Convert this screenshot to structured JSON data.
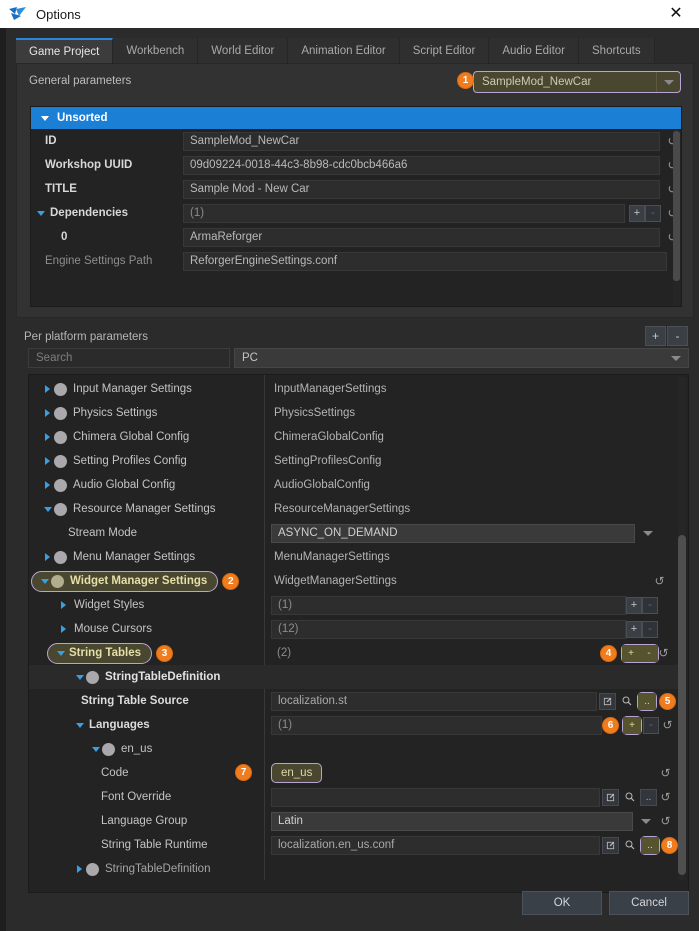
{
  "window": {
    "title": "Options",
    "close_icon": "close-icon",
    "logo_icon": "enfusion-logo-icon"
  },
  "tabs": [
    {
      "label": "Game Project",
      "active": true
    },
    {
      "label": "Workbench",
      "active": false
    },
    {
      "label": "World Editor",
      "active": false
    },
    {
      "label": "Animation Editor",
      "active": false
    },
    {
      "label": "Script Editor",
      "active": false
    },
    {
      "label": "Audio Editor",
      "active": false
    },
    {
      "label": "Shortcuts",
      "active": false
    }
  ],
  "general": {
    "label": "General parameters",
    "mod_dropdown_value": "SampleMod_NewCar",
    "group_header": "Unsorted",
    "rows": [
      {
        "label": "ID",
        "value": "SampleMod_NewCar"
      },
      {
        "label": "Workshop UUID",
        "value": "09d09224-0018-44c3-8b98-cdc0bcb466a6"
      },
      {
        "label": "TITLE",
        "value": "Sample Mod - New Car"
      },
      {
        "label": "Dependencies",
        "value": "(1)"
      },
      {
        "label": "0",
        "value": "ArmaReforger"
      },
      {
        "label": "Engine Settings Path",
        "value": "ReforgerEngineSettings.conf"
      }
    ]
  },
  "perplatform": {
    "label": "Per platform parameters",
    "add_label": "+",
    "remove_label": "-",
    "search_placeholder": "Search",
    "search_value": "",
    "platform_value": "PC"
  },
  "tree": [
    {
      "name": "Input Manager Settings",
      "value": "InputManagerSettings",
      "type": "node",
      "indent": 0,
      "expanded": false,
      "dot": true
    },
    {
      "name": "Physics Settings",
      "value": "PhysicsSettings",
      "type": "node",
      "indent": 0,
      "expanded": false,
      "dot": true
    },
    {
      "name": "Chimera Global Config",
      "value": "ChimeraGlobalConfig",
      "type": "node",
      "indent": 0,
      "expanded": false,
      "dot": true
    },
    {
      "name": "Setting Profiles Config",
      "value": "SettingProfilesConfig",
      "type": "node",
      "indent": 0,
      "expanded": false,
      "dot": true
    },
    {
      "name": "Audio Global Config",
      "value": "AudioGlobalConfig",
      "type": "node",
      "indent": 0,
      "expanded": false,
      "dot": true
    },
    {
      "name": "Resource Manager Settings",
      "value": "ResourceManagerSettings",
      "type": "node",
      "indent": 0,
      "expanded": true,
      "dot": true
    },
    {
      "name": "Stream Mode",
      "value": "ASYNC_ON_DEMAND",
      "type": "combo",
      "indent": 1,
      "dot": false
    },
    {
      "name": "Menu Manager Settings",
      "value": "MenuManagerSettings",
      "type": "node",
      "indent": 0,
      "expanded": false,
      "dot": true
    },
    {
      "name": "Widget Manager Settings",
      "value": "WidgetManagerSettings",
      "type": "node",
      "indent": 0,
      "expanded": true,
      "dot": true,
      "highlight": true,
      "marker": "2"
    },
    {
      "name": "Widget Styles",
      "value": "(1)",
      "type": "array",
      "indent": 1,
      "expanded": false
    },
    {
      "name": "Mouse Cursors",
      "value": "(12)",
      "type": "array",
      "indent": 1,
      "expanded": false
    },
    {
      "name": "String Tables",
      "value": "(2)",
      "type": "array",
      "indent": 1,
      "expanded": true,
      "highlight": true,
      "marker": "3",
      "value_marker": "4"
    },
    {
      "name": "StringTableDefinition",
      "value": "",
      "type": "node",
      "indent": 2,
      "expanded": true,
      "dot": true
    },
    {
      "name": "String Table Source",
      "value": "localization.st",
      "type": "resource",
      "indent": 3,
      "marker": "5"
    },
    {
      "name": "Languages",
      "value": "(1)",
      "type": "array",
      "indent": 3,
      "expanded": true,
      "marker": "6"
    },
    {
      "name": "en_us",
      "value": "",
      "type": "node",
      "indent": 4,
      "expanded": true,
      "dot": true
    },
    {
      "name": "Code",
      "value": "en_us",
      "type": "text",
      "indent": 5,
      "marker": "7",
      "value_highlight": true
    },
    {
      "name": "Font Override",
      "value": "",
      "type": "resource",
      "indent": 5
    },
    {
      "name": "Language Group",
      "value": "Latin",
      "type": "combo",
      "indent": 5
    },
    {
      "name": "String Table Runtime",
      "value": "localization.en_us.conf",
      "type": "resource",
      "indent": 5,
      "marker": "8"
    },
    {
      "name": "StringTableDefinition",
      "value": "",
      "type": "node",
      "indent": 2,
      "expanded": false,
      "dot": true
    }
  ],
  "icons": {
    "open_external": "open-external-icon",
    "search": "search-icon",
    "browse": "..",
    "revert": "↺",
    "add": "+",
    "remove": "-"
  },
  "footer": {
    "ok_label": "OK",
    "cancel_label": "Cancel"
  },
  "colors": {
    "accent_blue": "#1b7fd6",
    "marker_orange": "#f07c20",
    "highlight_border": "#b9a3d4",
    "highlight_fill": "#4a4730"
  }
}
